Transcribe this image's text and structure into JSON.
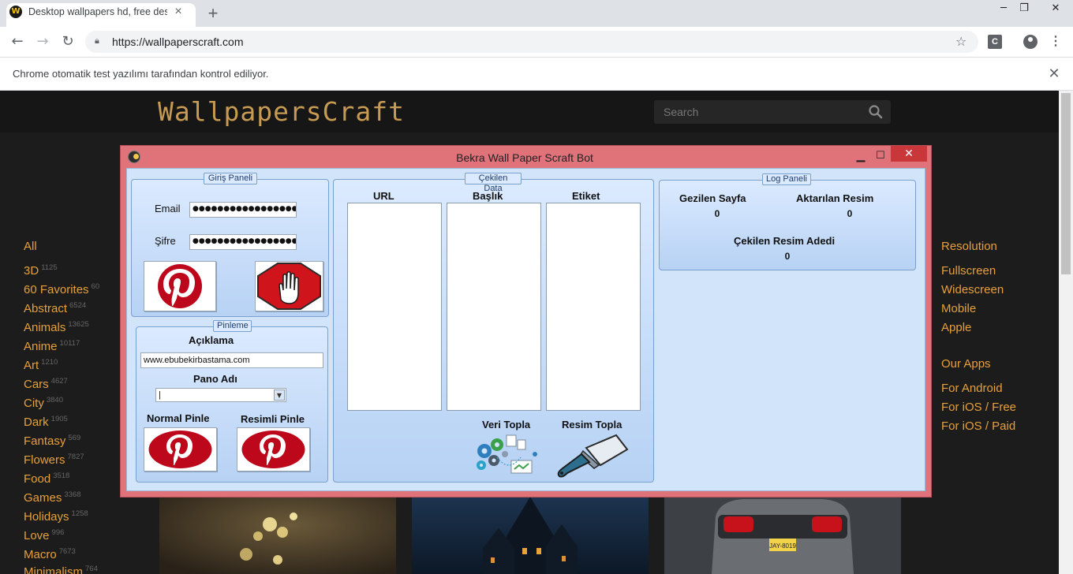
{
  "browser": {
    "tab_title": "Desktop wallpapers hd, free desk",
    "tab_favicon": "W",
    "new_tab": "+",
    "url": "https://wallpaperscraft.com",
    "extension_label": "C",
    "infobar_text": "Chrome otomatik test yazılımı tarafından kontrol ediliyor.",
    "window_controls": {
      "minimize": "─",
      "restore": "❐",
      "close": "✕"
    }
  },
  "site": {
    "logo": "WallpapersCraft",
    "search_placeholder": "Search",
    "categories": [
      {
        "name": "All",
        "count": ""
      },
      {
        "name": "3D",
        "count": "1125"
      },
      {
        "name": "60 Favorites",
        "count": "60"
      },
      {
        "name": "Abstract",
        "count": "6524"
      },
      {
        "name": "Animals",
        "count": "13625"
      },
      {
        "name": "Anime",
        "count": "10117"
      },
      {
        "name": "Art",
        "count": "1210"
      },
      {
        "name": "Cars",
        "count": "4627"
      },
      {
        "name": "City",
        "count": "3840"
      },
      {
        "name": "Dark",
        "count": "1905"
      },
      {
        "name": "Fantasy",
        "count": "569"
      },
      {
        "name": "Flowers",
        "count": "7827"
      },
      {
        "name": "Food",
        "count": "3518"
      },
      {
        "name": "Games",
        "count": "3368"
      },
      {
        "name": "Holidays",
        "count": "1258"
      },
      {
        "name": "Love",
        "count": "996"
      },
      {
        "name": "Macro",
        "count": "7673"
      },
      {
        "name": "Minimalism",
        "count": "764"
      }
    ],
    "resolution_title": "Resolution",
    "resolutions": [
      "Fullscreen",
      "Widescreen",
      "Mobile",
      "Apple"
    ],
    "apps_title": "Our Apps",
    "apps": [
      "For Android",
      "For iOS / Free",
      "For iOS / Paid"
    ],
    "plate_text": "JAY-8019"
  },
  "app": {
    "title": "Bekra Wall Paper Scraft Bot",
    "login": {
      "group_title": "Giriş Paneli",
      "email_label": "Email",
      "email_value": "●●●●●●●●●●●●●●●●●●●●",
      "password_label": "Şifre",
      "password_value": "●●●●●●●●●●●●●●●●●●●●"
    },
    "pin": {
      "group_title": "Pinleme",
      "description_label": "Açıklama",
      "description_value": "www.ebubekirbastama.com",
      "board_label": "Pano Adı",
      "board_value": "|",
      "normal_pin": "Normal Pinle",
      "image_pin": "Resimli Pinle"
    },
    "data": {
      "group_title": "Çekilen Data",
      "col_url": "URL",
      "col_title": "Başlık",
      "col_tag": "Etiket",
      "collect_data": "Veri Topla",
      "collect_images": "Resim Topla"
    },
    "log": {
      "group_title": "Log Paneli",
      "pages_label": "Gezilen Sayfa",
      "pages_value": "0",
      "transferred_label": "Aktarılan Resim",
      "transferred_value": "0",
      "pulled_label": "Çekilen Resim Adedi",
      "pulled_value": "0"
    },
    "window_controls": {
      "minimize": "▁",
      "maximize": "☐",
      "close": "✕"
    }
  },
  "colors": {
    "site_accent": "#e8a03a",
    "logo": "#c79b52",
    "window_frame": "#e0727a",
    "client_bg": "#d1e4fa",
    "pinterest_red": "#bd081c"
  }
}
